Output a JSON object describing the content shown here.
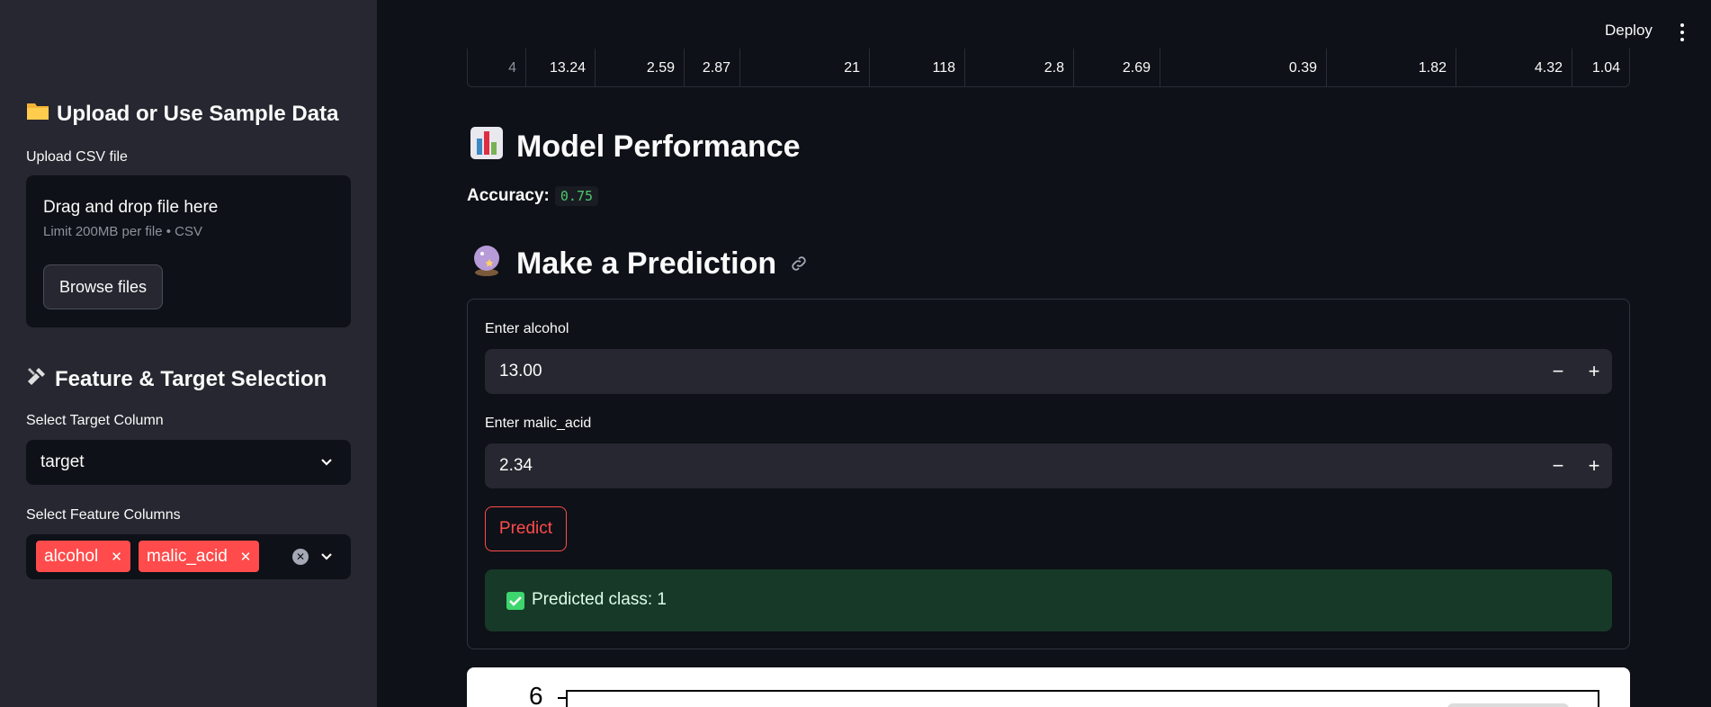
{
  "sidebar": {
    "upload_heading": "Upload or Use Sample Data",
    "upload_label": "Upload CSV file",
    "dropzone_title": "Drag and drop file here",
    "dropzone_hint": "Limit 200MB per file • CSV",
    "browse_button": "Browse files",
    "feature_heading": "Feature & Target Selection",
    "target_label": "Select Target Column",
    "target_value": "target",
    "features_label": "Select Feature Columns",
    "selected_features": [
      "alcohol",
      "malic_acid"
    ]
  },
  "header": {
    "deploy_label": "Deploy"
  },
  "table_row": {
    "index": "4",
    "values": [
      "13.24",
      "2.59",
      "2.87",
      "21",
      "118",
      "2.8",
      "2.69",
      "0.39",
      "1.82",
      "4.32",
      "1.04"
    ]
  },
  "main": {
    "performance_title": "Model Performance",
    "accuracy_label": "Accuracy:",
    "accuracy_value": "0.75",
    "prediction_title": "Make a Prediction",
    "inputs": [
      {
        "label": "Enter alcohol",
        "value": "13.00"
      },
      {
        "label": "Enter malic_acid",
        "value": "2.34"
      }
    ],
    "predict_button": "Predict",
    "result_text": "Predicted class: 1"
  },
  "plot": {
    "visible_tick": "6"
  },
  "colors": {
    "accent": "#ff4b4b",
    "success_bg": "#173928",
    "sidebar_bg": "#262730",
    "main_bg": "#0e1117"
  }
}
